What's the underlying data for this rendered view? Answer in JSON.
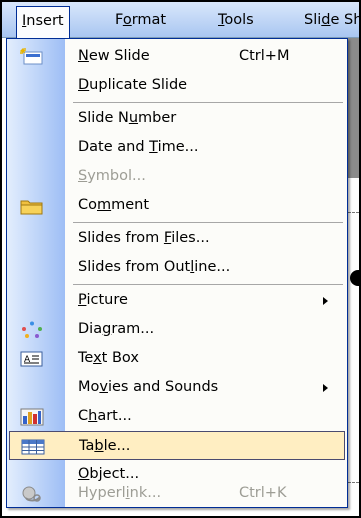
{
  "menubar": {
    "items": [
      {
        "label": "Insert",
        "mnemonic": "I",
        "active": true
      },
      {
        "label": "Format",
        "mnemonic": "o",
        "active": false
      },
      {
        "label": "Tools",
        "mnemonic": "T",
        "active": false
      },
      {
        "label": "Slide Sh",
        "mnemonic": "d",
        "active": false
      }
    ]
  },
  "insert_menu": {
    "items": [
      {
        "label": "New Slide",
        "mnemonic": "N",
        "shortcut": "Ctrl+M",
        "icon": "new-slide-icon"
      },
      {
        "label": "Duplicate Slide",
        "mnemonic": "D"
      },
      {
        "label": "Slide Number",
        "mnemonic": "u"
      },
      {
        "label": "Date and Time...",
        "mnemonic": "T"
      },
      {
        "label": "Symbol...",
        "mnemonic": "S",
        "disabled": true
      },
      {
        "label": "Comment",
        "mnemonic": "m",
        "icon": "comment-icon"
      },
      {
        "label": "Slides from Files...",
        "mnemonic": "F"
      },
      {
        "label": "Slides from Outline...",
        "mnemonic": "L"
      },
      {
        "label": "Picture",
        "mnemonic": "P",
        "submenu": true
      },
      {
        "label": "Diagram...",
        "mnemonic": "G",
        "icon": "diagram-icon"
      },
      {
        "label": "Text Box",
        "mnemonic": "X",
        "icon": "text-box-icon"
      },
      {
        "label": "Movies and Sounds",
        "mnemonic": "V",
        "submenu": true
      },
      {
        "label": "Chart...",
        "mnemonic": "H",
        "icon": "chart-icon"
      },
      {
        "label": "Table...",
        "mnemonic": "B",
        "icon": "table-icon",
        "highlighted": true
      },
      {
        "label": "Object...",
        "mnemonic": "O"
      },
      {
        "label": "Hyperlink...",
        "mnemonic": "I",
        "shortcut": "Ctrl+K",
        "icon": "hyperlink-icon",
        "disabled": true
      }
    ]
  },
  "colors": {
    "menubar_gradient": [
      "#d9e7fb",
      "#a9c6f1"
    ],
    "menu_border": "#002d96",
    "highlight_fill": "#ffeec2",
    "disabled_text": "#9d9d95"
  }
}
